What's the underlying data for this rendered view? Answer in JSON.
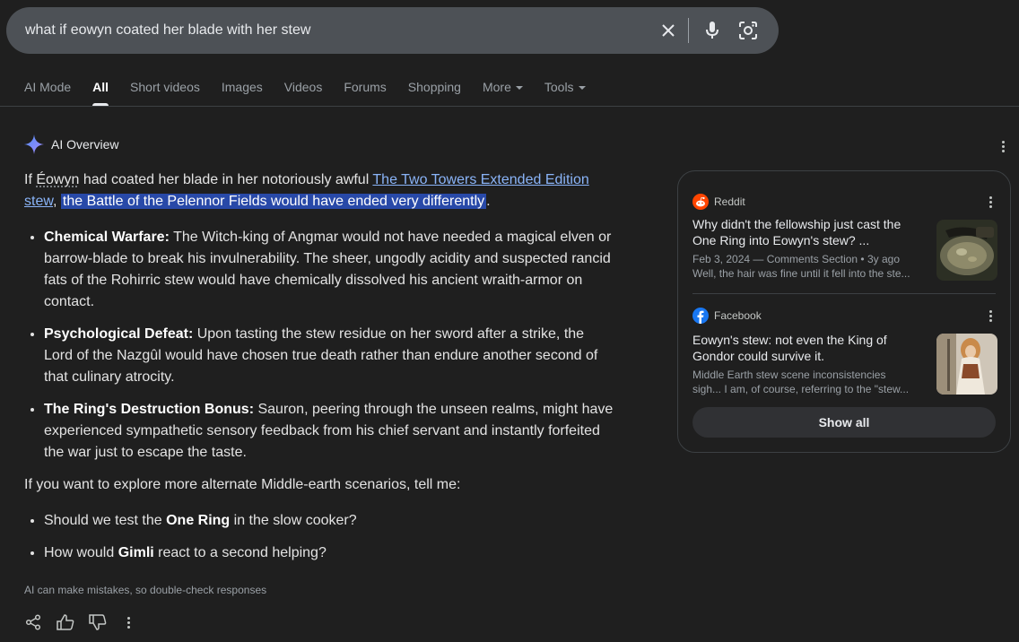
{
  "search": {
    "query": "what if eowyn coated her blade with her stew"
  },
  "tabs": [
    {
      "label": "AI Mode"
    },
    {
      "label": "All"
    },
    {
      "label": "Short videos"
    },
    {
      "label": "Images"
    },
    {
      "label": "Videos"
    },
    {
      "label": "Forums"
    },
    {
      "label": "Shopping"
    },
    {
      "label": "More"
    },
    {
      "label": "Tools"
    }
  ],
  "active_tab": "All",
  "ai_overview": {
    "title": "AI Overview",
    "intro": {
      "prefix": "If ",
      "name": "Éowyn",
      "mid": " had coated her blade in her notoriously awful ",
      "link": "The Two Towers Extended Edition stew",
      "comma": ", ",
      "highlight": "the Battle of the Pelennor Fields would have ended very differently",
      "end": "."
    },
    "points": [
      {
        "term": "Chemical Warfare:",
        "text": " The Witch-king of Angmar would not have needed a magical elven or barrow-blade to break his invulnerability. The sheer, ungodly acidity and suspected rancid fats of the Rohirric stew would have chemically dissolved his ancient wraith-armor on contact."
      },
      {
        "term": "Psychological Defeat:",
        "text": " Upon tasting the stew residue on her sword after a strike, the Lord of the Nazgûl would have chosen true death rather than endure another second of that culinary atrocity."
      },
      {
        "term": "The Ring's Destruction Bonus:",
        "text": " Sauron, peering through the unseen realms, might have experienced sympathetic sensory feedback from his chief servant and instantly forfeited the war just to escape the taste."
      }
    ],
    "followup": "If you want to explore more alternate Middle-earth scenarios, tell me:",
    "suggestions": [
      {
        "pre": "Should we test the ",
        "bold": "One Ring",
        "post": " in the slow cooker?"
      },
      {
        "pre": "How would ",
        "bold": "Gimli",
        "post": " react to a second helping?"
      }
    ],
    "disclaimer": "AI can make mistakes, so double-check responses"
  },
  "sources": [
    {
      "site": "Reddit",
      "title": "Why didn't the fellowship just cast the One Ring into Eowyn's stew? ...",
      "meta1": "Feb 3, 2024 — Comments Section • 3y ago",
      "meta2": "Well, the hair was fine until it fell into the ste..."
    },
    {
      "site": "Facebook",
      "title": "Eowyn's stew: not even the King of Gondor could survive it.",
      "meta1": "Middle Earth stew scene inconsistencies",
      "meta2": "sigh... I am, of course, referring to the \"stew..."
    }
  ],
  "show_all_label": "Show all",
  "colors": {
    "link": "#8ab4f8",
    "highlight": "#2849a8",
    "reddit": "#ff4500",
    "facebook": "#1877f2"
  }
}
